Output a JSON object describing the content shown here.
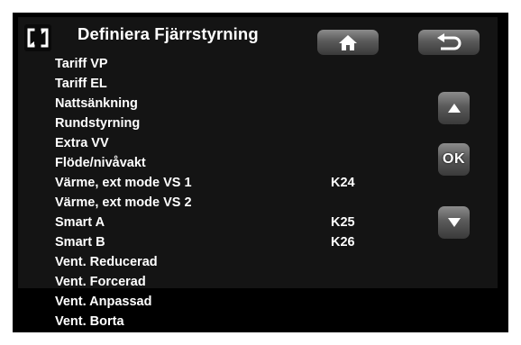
{
  "header": {
    "title": "Definiera Fjärrstyrning"
  },
  "icons": {
    "corner": "back-navigation-icon",
    "home": "home-icon",
    "back": "return-arrow-icon",
    "up": "up-arrow-icon",
    "down": "down-arrow-icon"
  },
  "buttons": {
    "ok_label": "OK"
  },
  "list": {
    "items": [
      {
        "label": "Tariff VP",
        "value": ""
      },
      {
        "label": "Tariff EL",
        "value": ""
      },
      {
        "label": "Nattsänkning",
        "value": ""
      },
      {
        "label": "Rundstyrning",
        "value": ""
      },
      {
        "label": "Extra VV",
        "value": ""
      },
      {
        "label": "Flöde/nivåvakt",
        "value": ""
      },
      {
        "label": "Värme, ext mode VS 1",
        "value": "K24"
      },
      {
        "label": "Värme, ext mode VS 2",
        "value": ""
      },
      {
        "label": "Smart A",
        "value": "K25"
      },
      {
        "label": "Smart B",
        "value": "K26"
      },
      {
        "label": "Vent. Reducerad",
        "value": ""
      },
      {
        "label": "Vent. Forcerad",
        "value": ""
      },
      {
        "label": "Vent. Anpassad",
        "value": ""
      },
      {
        "label": "Vent. Borta",
        "value": ""
      }
    ]
  },
  "colors": {
    "background": "#000000",
    "panel": "#141414",
    "text": "#ffffff",
    "button": "#6a6a6a"
  }
}
